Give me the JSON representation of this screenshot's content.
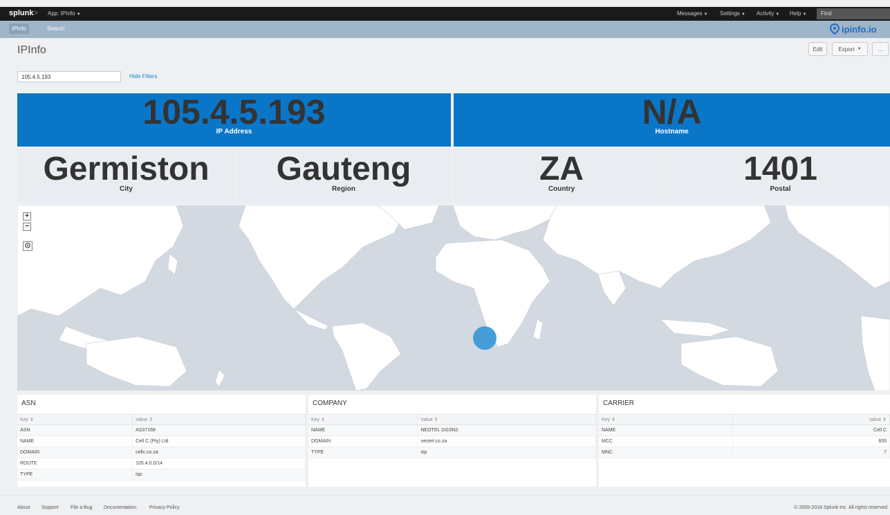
{
  "topbar": {
    "logo": "splunk",
    "logo_suffix": ">",
    "app_label": "App: IPInfo",
    "menus": [
      "Messages",
      "Settings",
      "Activity",
      "Help"
    ],
    "find_placeholder": "Find"
  },
  "appbar": {
    "tabs": [
      "IPInfo",
      "Search"
    ],
    "brand": "ipinfo.io"
  },
  "page": {
    "title": "IPInfo",
    "edit_label": "Edit",
    "export_label": "Export",
    "more_label": "..."
  },
  "filters": {
    "ip_value": "105.4.5.193",
    "hide_filters_label": "Hide Filters"
  },
  "singles": {
    "ip": {
      "value": "105.4.5.193",
      "label": "IP Address"
    },
    "hostname": {
      "value": "N/A",
      "label": "Hostname"
    },
    "city": {
      "value": "Germiston",
      "label": "City"
    },
    "region": {
      "value": "Gauteng",
      "label": "Region"
    },
    "country": {
      "value": "ZA",
      "label": "Country"
    },
    "postal": {
      "value": "1401",
      "label": "Postal"
    }
  },
  "map": {
    "zoom_in": "+",
    "zoom_out": "−",
    "marker_color": "#3d9ad6"
  },
  "tables": {
    "asn": {
      "title": "ASN",
      "headers": [
        "Key",
        "Value"
      ],
      "rows": [
        [
          "ASN",
          "AS37168"
        ],
        [
          "NAME",
          "Cell C (Pty) Ltd"
        ],
        [
          "DOMAIN",
          "cellc.co.za"
        ],
        [
          "ROUTE",
          "105.4.0.0/14"
        ],
        [
          "TYPE",
          "isp"
        ]
      ]
    },
    "company": {
      "title": "COMPANY",
      "headers": [
        "Key",
        "Value"
      ],
      "rows": [
        [
          "NAME",
          "NEOTEL GGSN2"
        ],
        [
          "DOMAIN",
          "neotel.co.za"
        ],
        [
          "TYPE",
          "isp"
        ]
      ]
    },
    "carrier": {
      "title": "CARRIER",
      "headers": [
        "Key",
        "Value"
      ],
      "rows": [
        [
          "NAME",
          "Cell C"
        ],
        [
          "MCC",
          "655"
        ],
        [
          "MNC",
          "7"
        ]
      ]
    }
  },
  "footer": {
    "links": [
      "About",
      "Support",
      "File a Bug",
      "Documentation",
      "Privacy Policy"
    ],
    "copyright": "© 2005-2018 Splunk Inc. All rights reserved."
  },
  "colors": {
    "blue_panel": "#0a76c8",
    "grey_panel": "#e9edf1",
    "appbar": "#9fb5c9"
  }
}
